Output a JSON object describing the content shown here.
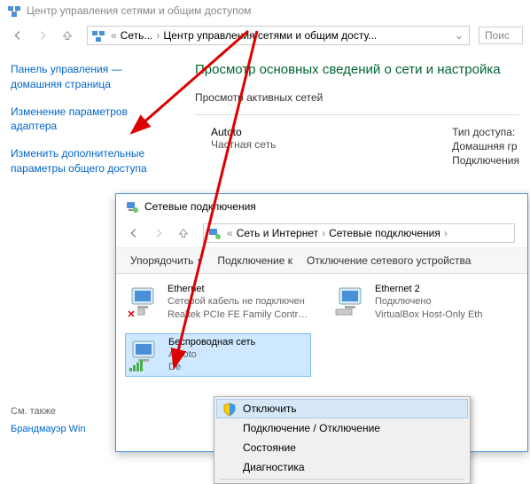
{
  "win1": {
    "title": "Центр управления сетями и общим доступом",
    "crumb1": "Сеть...",
    "crumb2": "Центр управления сетями и общим досту...",
    "search_placeholder": "Поис",
    "sidebar": {
      "home": "Панель управления — домашняя страница",
      "adapters": "Изменение параметров адаптера",
      "sharing": "Изменить дополнительные параметры общего доступа",
      "see_also": "См. также",
      "firewall": "Брандмауэр Win"
    },
    "content": {
      "heading": "Просмотр основных сведений о сети и настройка",
      "subhead": "Просмотр активных сетей",
      "net_name": "Autoto",
      "net_type": "Частная сеть",
      "access_label": "Тип доступа:",
      "home_label": "Домашняя гр",
      "conn_label": "Подключения"
    }
  },
  "win2": {
    "title": "Сетевые подключения",
    "crumb1": "Сеть и Интернет",
    "crumb2": "Сетевые подключения",
    "toolbar": {
      "organize": "Упорядочить",
      "connect": "Подключение к",
      "disable": "Отключение сетевого устройства"
    },
    "adapters": [
      {
        "name": "Ethernet",
        "status": "Сетевой кабель не подключен",
        "device": "Realtek PCIe FE Family Controller"
      },
      {
        "name": "Ethernet 2",
        "status": "Подключено",
        "device": "VirtualBox Host-Only Eth"
      },
      {
        "name": "Беспроводная сеть",
        "status": "Autoto",
        "device": "De"
      }
    ],
    "ctx": {
      "disable": "Отключить",
      "toggle": "Подключение / Отключение",
      "status": "Состояние",
      "diag": "Диагностика"
    }
  }
}
